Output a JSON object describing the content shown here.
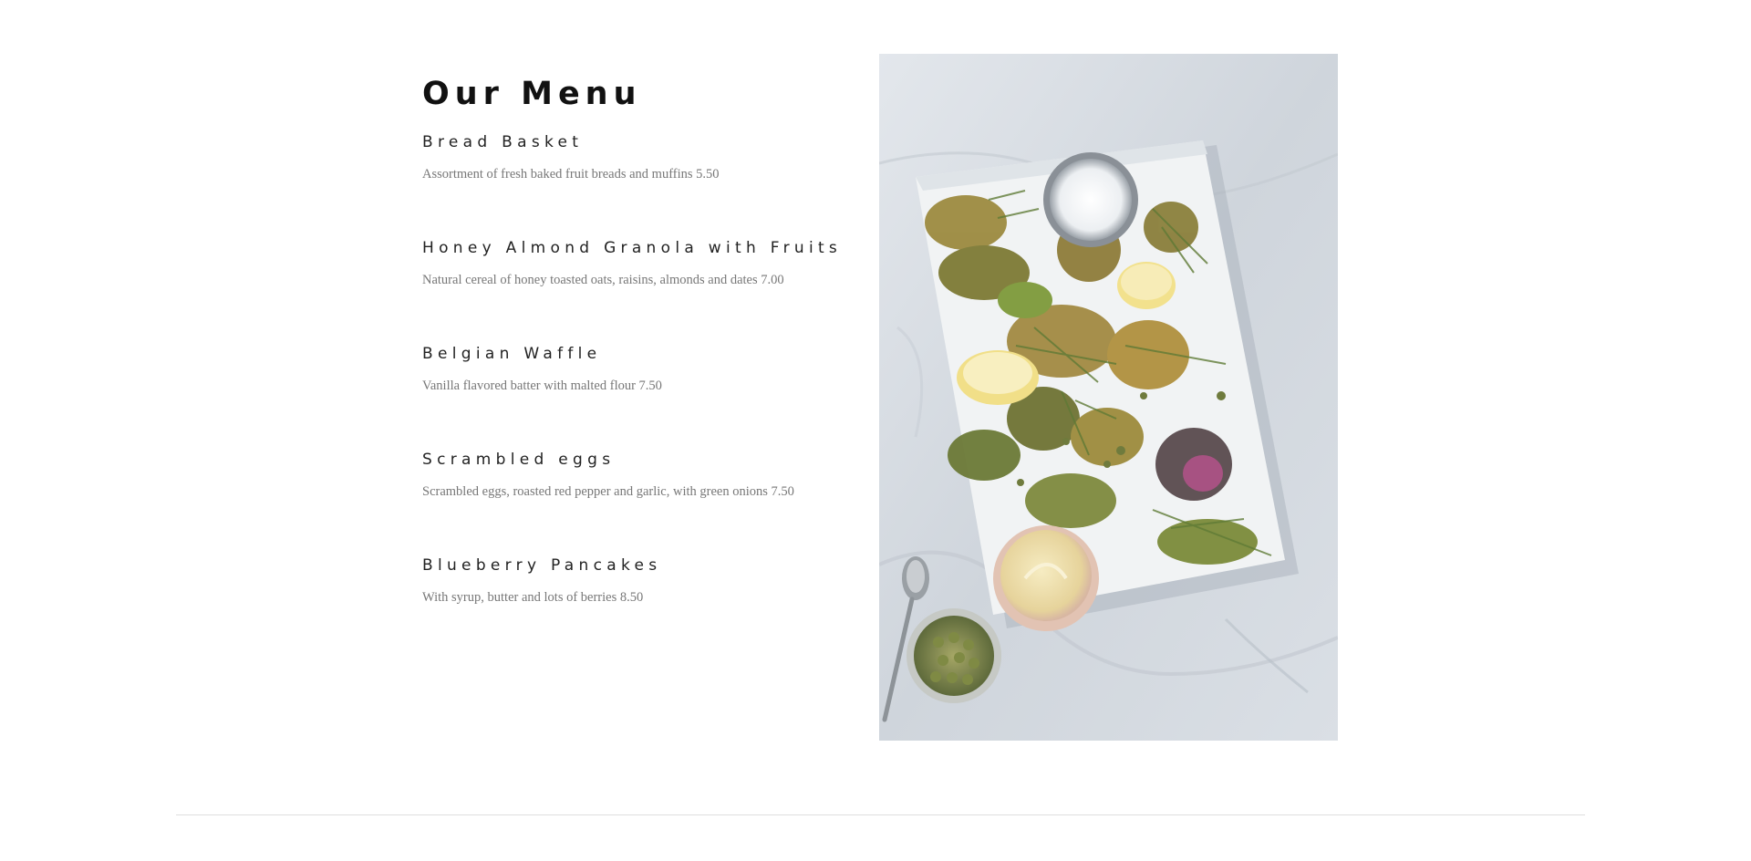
{
  "menu": {
    "title": "Our Menu",
    "items": [
      {
        "name": "Bread Basket",
        "description": "Assortment of fresh baked fruit breads and muffins 5.50"
      },
      {
        "name": "Honey Almond Granola with Fruits",
        "description": "Natural cereal of honey toasted oats, raisins, almonds and dates 7.00"
      },
      {
        "name": "Belgian Waffle",
        "description": "Vanilla flavored batter with malted flour 7.50"
      },
      {
        "name": "Scrambled eggs",
        "description": "Scrambled eggs, roasted red pepper and garlic, with green onions 7.50"
      },
      {
        "name": "Blueberry Pancakes",
        "description": "With syrup, butter and lots of berries 8.50"
      }
    ]
  },
  "photo": {
    "icon": "food-platter-photo"
  },
  "colors": {
    "background": "#ffffff",
    "heading": "#111111",
    "item_name": "#222222",
    "description": "#777777",
    "divider": "#dedede"
  }
}
